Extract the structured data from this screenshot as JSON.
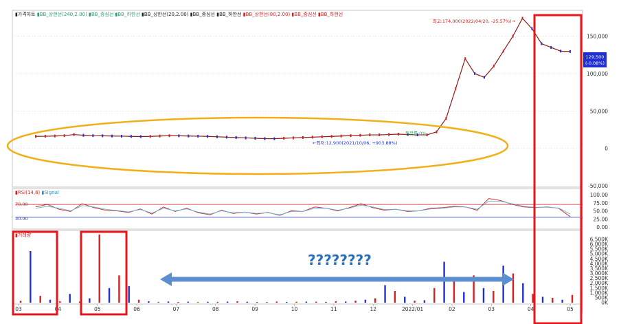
{
  "legends": {
    "price_pane": [
      {
        "text": "▮가격차트",
        "color": "#222222"
      },
      {
        "text": "▮BB_상한선(240,2.00)",
        "color": "#2a9d6a"
      },
      {
        "text": "▮BB_중심선",
        "color": "#2a9d6a"
      },
      {
        "text": "▮BB_하한선",
        "color": "#2a9d6a"
      },
      {
        "text": "▮BB_상한선(20,2.00)",
        "color": "#222222"
      },
      {
        "text": "▮BB_중심선",
        "color": "#222222"
      },
      {
        "text": "▮BB_하한선",
        "color": "#222222"
      },
      {
        "text": "▮BB_상한선(80,2.00)",
        "color": "#d42020"
      },
      {
        "text": "▮BB_중심선",
        "color": "#d42020"
      },
      {
        "text": "▮BB_하한선",
        "color": "#d42020"
      }
    ],
    "rsi_pane": [
      {
        "text": "▮RSI(14,6)",
        "color": "#d42020"
      },
      {
        "text": "▮Signal",
        "color": "#2a8fcf"
      }
    ],
    "volume_pane": [
      {
        "text": "▮거래량",
        "color": "#d42020"
      }
    ]
  },
  "annotations": {
    "max_label": "최고:174,000(2022/04/20, -25.57%)→",
    "min_label": "←최저:12,900(2021/10/06, +903.88%)",
    "rate_label": "등락률:0%",
    "last_price": "129,500",
    "last_change": "(-0.08%)",
    "rsi_level_high": "70.00",
    "rsi_level_low": "30.00",
    "overlay_question": "????????"
  },
  "axes": {
    "price_ticks": [
      "150,000",
      "100,000",
      "50,000",
      "0",
      "-50,000"
    ],
    "rsi_ticks": [
      "100.00",
      "75.00",
      "50.00",
      "25.00",
      "0.00"
    ],
    "volume_ticks": [
      "6,500K",
      "6,000K",
      "5,500K",
      "5,000K",
      "4,500K",
      "4,000K",
      "3,500K",
      "3,000K",
      "2,500K",
      "2,000K",
      "1,500K",
      "1,000K",
      "500K",
      "0K"
    ],
    "x_ticks": [
      "03",
      "04",
      "05",
      "06",
      "07",
      "08",
      "09",
      "10",
      "11",
      "12",
      "2022/01",
      "02",
      "03",
      "04",
      "05"
    ]
  },
  "colors": {
    "up": "#d42020",
    "down": "#1f2fd0",
    "highlight_box": "#e8161b",
    "ellipse": "#f0b019",
    "arrow": "#5b8fd0",
    "rsi_line": "#d42020",
    "signal_line": "#5fb3d9",
    "grid": "#dddddd"
  },
  "chart_data": [
    {
      "type": "line",
      "title": "",
      "series": [
        {
          "name": "가격차트",
          "values": [
            16000,
            16200,
            16500,
            17000,
            18500,
            17500,
            17000,
            16800,
            16500,
            16300,
            16000,
            15800,
            16000,
            16500,
            17000,
            16800,
            16500,
            16300,
            16000,
            15500,
            15000,
            14500,
            14000,
            13500,
            13000,
            12900,
            13500,
            14000,
            14500,
            15000,
            15500,
            16000,
            16500,
            17000,
            17500,
            18000,
            18000,
            18500,
            19000,
            18500,
            18000,
            18000,
            22000,
            40000,
            80000,
            120000,
            100000,
            95000,
            110000,
            130000,
            150000,
            174000,
            160000,
            140000,
            135000,
            130000,
            129500
          ]
        }
      ],
      "x": [
        "2021/03",
        "2021/03",
        "2021/04",
        "2021/04",
        "2021/05",
        "2021/05",
        "2021/05",
        "2021/06",
        "2021/06",
        "2021/07",
        "2021/07",
        "2021/08",
        "2021/08",
        "2021/08",
        "2021/09",
        "2021/09",
        "2021/09",
        "2021/10",
        "2021/10",
        "2021/10",
        "2021/10",
        "2021/10",
        "2021/10",
        "2021/10",
        "2021/10",
        "2021/10",
        "2021/11",
        "2021/11",
        "2021/11",
        "2021/11",
        "2021/12",
        "2021/12",
        "2021/12",
        "2022/01",
        "2022/01",
        "2022/01",
        "2022/02",
        "2022/02",
        "2022/02",
        "2022/03",
        "2022/03",
        "2022/03",
        "2022/03",
        "2022/04",
        "2022/04",
        "2022/04",
        "2022/04",
        "2022/04",
        "2022/04",
        "2022/04",
        "2022/04",
        "2022/04",
        "2022/05",
        "2022/05",
        "2022/05",
        "2022/05",
        "2022/05"
      ],
      "ylim": [
        -50000,
        180000
      ],
      "max": {
        "value": 174000,
        "date": "2022/04/20"
      },
      "min": {
        "value": 12900,
        "date": "2021/10/06"
      },
      "last": 129500
    },
    {
      "type": "line",
      "title": "",
      "series": [
        {
          "name": "RSI(14,6)",
          "values": [
            62,
            70,
            55,
            48,
            72,
            60,
            52,
            50,
            45,
            56,
            40,
            62,
            48,
            58,
            44,
            38,
            52,
            42,
            46,
            40,
            45,
            36,
            50,
            48,
            62,
            58,
            50,
            60,
            72,
            60,
            52,
            55,
            48,
            50,
            58,
            60,
            64,
            62,
            52,
            88,
            82,
            70,
            62,
            60,
            62,
            58,
            32
          ]
        },
        {
          "name": "Signal",
          "values": [
            58,
            64,
            58,
            50,
            66,
            62,
            55,
            51,
            47,
            54,
            43,
            58,
            50,
            56,
            46,
            40,
            50,
            44,
            46,
            42,
            44,
            38,
            48,
            48,
            58,
            58,
            52,
            58,
            68,
            62,
            54,
            55,
            50,
            50,
            56,
            58,
            62,
            62,
            55,
            80,
            80,
            72,
            64,
            61,
            61,
            59,
            40
          ]
        }
      ],
      "levels": [
        70,
        30
      ],
      "ylim": [
        0,
        100
      ]
    },
    {
      "type": "bar",
      "title": "",
      "series": [
        {
          "name": "거래량",
          "values": [
            200,
            5300,
            700,
            300,
            150,
            900,
            120,
            450,
            7000,
            1500,
            2800,
            1700,
            300,
            150,
            80,
            120,
            70,
            100,
            60,
            90,
            80,
            110,
            150,
            90,
            70,
            60,
            120,
            80,
            90,
            110,
            100,
            80,
            150,
            120,
            200,
            300,
            450,
            1800,
            1200,
            600,
            200,
            250,
            1500,
            4200,
            2200,
            1100,
            2800,
            1500,
            1200,
            3800,
            3000,
            2000,
            900,
            600,
            500,
            300,
            800
          ]
        }
      ],
      "ylim": [
        0,
        6500
      ]
    }
  ]
}
